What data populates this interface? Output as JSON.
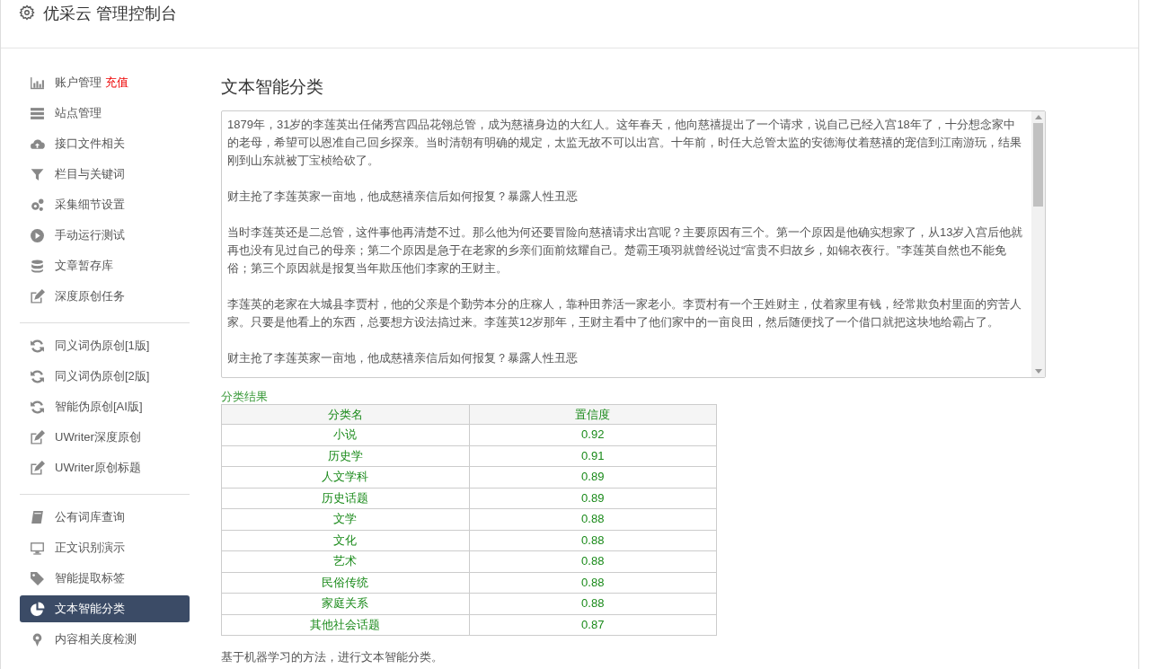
{
  "window": {
    "title": "优采云 管理控制台"
  },
  "sidebar": {
    "groups": [
      {
        "items": [
          {
            "label": "账户管理",
            "badge": "充值",
            "selected": false
          },
          {
            "label": "站点管理",
            "selected": false
          },
          {
            "label": "接口文件相关",
            "selected": false
          },
          {
            "label": "栏目与关键词",
            "selected": false
          },
          {
            "label": "采集细节设置",
            "selected": false
          },
          {
            "label": "手动运行测试",
            "selected": false
          },
          {
            "label": "文章暂存库",
            "selected": false
          },
          {
            "label": "深度原创任务",
            "selected": false
          }
        ]
      },
      {
        "items": [
          {
            "label": "同义词伪原创[1版]",
            "selected": false
          },
          {
            "label": "同义词伪原创[2版]",
            "selected": false
          },
          {
            "label": "智能伪原创[AI版]",
            "selected": false
          },
          {
            "label": "UWriter深度原创",
            "selected": false
          },
          {
            "label": "UWriter原创标题",
            "selected": false
          }
        ]
      },
      {
        "items": [
          {
            "label": "公有词库查询",
            "selected": false
          },
          {
            "label": "正文识别演示",
            "selected": false
          },
          {
            "label": "智能提取标签",
            "selected": false
          },
          {
            "label": "文本智能分类",
            "selected": true
          },
          {
            "label": "内容相关度检测",
            "selected": false
          }
        ]
      }
    ]
  },
  "main": {
    "title": "文本智能分类",
    "text_input": {
      "paragraphs": [
        "1879年，31岁的李莲英出任储秀宫四品花翎总管，成为慈禧身边的大红人。这年春天，他向慈禧提出了一个请求，说自己已经入宫18年了，十分想念家中的老母，希望可以恩准自己回乡探亲。当时清朝有明确的规定，太监无故不可以出宫。十年前，时任大总管太监的安德海仗着慈禧的宠信到江南游玩，结果刚到山东就被丁宝桢给砍了。",
        "财主抢了李莲英家一亩地，他成慈禧亲信后如何报复？暴露人性丑恶",
        "当时李莲英还是二总管，这件事他再清楚不过。那么他为何还要冒险向慈禧请求出宫呢？主要原因有三个。第一个原因是他确实想家了，从13岁入宫后他就再也没有见过自己的母亲；第二个原因是急于在老家的乡亲们面前炫耀自己。楚霸王项羽就曾经说过“富贵不归故乡，如锦衣夜行。”李莲英自然也不能免俗；第三个原因就是报复当年欺压他们李家的王财主。",
        "李莲英的老家在大城县李贾村，他的父亲是个勤劳本分的庄稼人，靠种田养活一家老小。李贾村有一个王姓财主，仗着家里有钱，经常欺负村里面的穷苦人家。只要是他看上的东西，总要想方设法搞过来。李莲英12岁那年，王财主看中了他们家中的一亩良田，然后随便找了一个借口就把这块地给霸占了。",
        "财主抢了李莲英家一亩地，他成慈禧亲信后如何报复？暴露人性丑恶"
      ]
    },
    "result_label": "分类结果",
    "table": {
      "columns": [
        "分类名",
        "置信度"
      ],
      "rows": [
        [
          "小说",
          "0.92"
        ],
        [
          "历史学",
          "0.91"
        ],
        [
          "人文学科",
          "0.89"
        ],
        [
          "历史话题",
          "0.89"
        ],
        [
          "文学",
          "0.88"
        ],
        [
          "文化",
          "0.88"
        ],
        [
          "艺术",
          "0.88"
        ],
        [
          "民俗传统",
          "0.88"
        ],
        [
          "家庭关系",
          "0.88"
        ],
        [
          "其他社会话题",
          "0.87"
        ]
      ]
    },
    "note": "基于机器学习的方法，进行文本智能分类。"
  }
}
